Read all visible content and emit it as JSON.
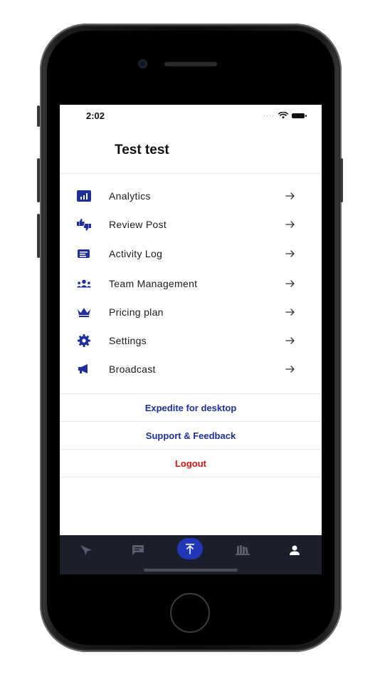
{
  "status_bar": {
    "time": "2:02"
  },
  "profile": {
    "name": "Test test"
  },
  "menu": {
    "items": [
      {
        "label": "Analytics",
        "icon": "analytics-icon"
      },
      {
        "label": "Review Post",
        "icon": "thumbs-up-down-icon"
      },
      {
        "label": "Activity Log",
        "icon": "activity-log-icon"
      },
      {
        "label": "Team Management",
        "icon": "team-icon"
      },
      {
        "label": "Pricing plan",
        "icon": "crown-icon"
      },
      {
        "label": "Settings",
        "icon": "gear-icon"
      },
      {
        "label": "Broadcast",
        "icon": "megaphone-icon"
      }
    ]
  },
  "links": {
    "desktop": "Expedite for desktop",
    "support": "Support & Feedback",
    "logout": "Logout"
  },
  "tab_bar": {
    "tabs": [
      {
        "icon": "send-icon",
        "active": false
      },
      {
        "icon": "chat-icon",
        "active": false
      },
      {
        "icon": "upload-icon",
        "active": false
      },
      {
        "icon": "library-icon",
        "active": false
      },
      {
        "icon": "user-icon",
        "active": true
      }
    ]
  },
  "colors": {
    "brand_blue": "#1e2f9c",
    "logout_red": "#e01212",
    "tab_bar_bg": "#1b1e2b",
    "tab_center_bg": "#2236b8"
  }
}
